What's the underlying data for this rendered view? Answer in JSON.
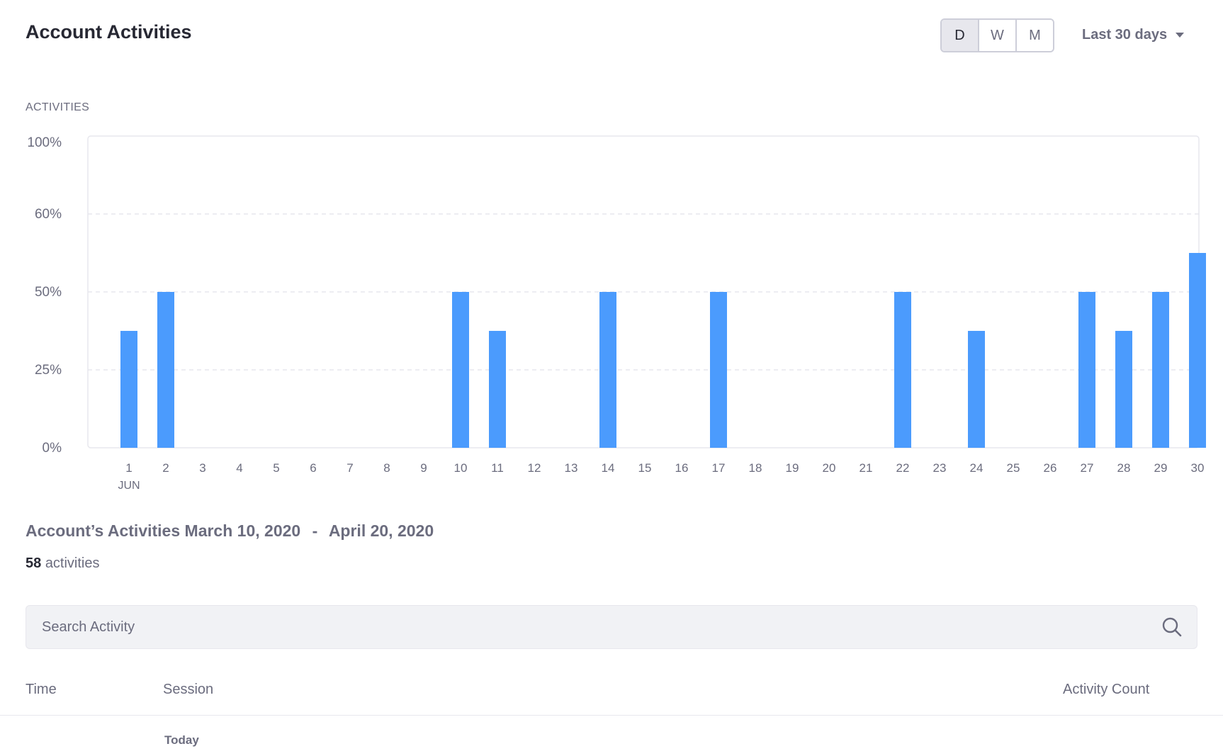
{
  "header": {
    "title": "Account Activities",
    "period_buttons": [
      {
        "label": "D",
        "active": true
      },
      {
        "label": "W",
        "active": false
      },
      {
        "label": "M",
        "active": false
      }
    ],
    "range_label": "Last 30 days",
    "range_icon": "caret-down-icon"
  },
  "chart_section_label": "ACTIVITIES",
  "chart_data": {
    "type": "bar",
    "categories": [
      "1",
      "2",
      "3",
      "4",
      "5",
      "6",
      "7",
      "8",
      "9",
      "10",
      "11",
      "12",
      "13",
      "14",
      "15",
      "16",
      "17",
      "18",
      "19",
      "20",
      "21",
      "22",
      "23",
      "24",
      "25",
      "26",
      "27",
      "28",
      "29",
      "30"
    ],
    "x_sublabel": "JUN",
    "values": [
      37.5,
      50,
      0,
      0,
      0,
      0,
      0,
      0,
      0,
      50,
      37.5,
      0,
      0,
      50,
      0,
      0,
      50,
      0,
      0,
      0,
      0,
      50,
      0,
      37.5,
      0,
      0,
      50,
      37.5,
      50,
      62.5
    ],
    "y_ticks": [
      "0%",
      "25%",
      "50%",
      "60%",
      "100%"
    ],
    "ylim": [
      0,
      100
    ],
    "grid": "horizontal dashed",
    "bar_color": "#4b9bfd",
    "title": "",
    "xlabel": "",
    "ylabel": ""
  },
  "summary": {
    "title_prefix": "Account’s Activities",
    "date_from": "March 10, 2020",
    "separator": "-",
    "date_to": "April 20, 2020",
    "count": "58",
    "count_label": "activities"
  },
  "search": {
    "placeholder": "Search Activity",
    "value": "",
    "icon": "search-icon"
  },
  "table": {
    "columns": [
      "Time",
      "Session",
      "Activity Count"
    ],
    "groups": [
      {
        "label": "Today"
      }
    ]
  },
  "colors": {
    "accent": "#4b9bfd",
    "text_primary": "#272833",
    "text_secondary": "#6b6c7e",
    "border": "#cdced9",
    "surface": "#f1f2f5"
  }
}
